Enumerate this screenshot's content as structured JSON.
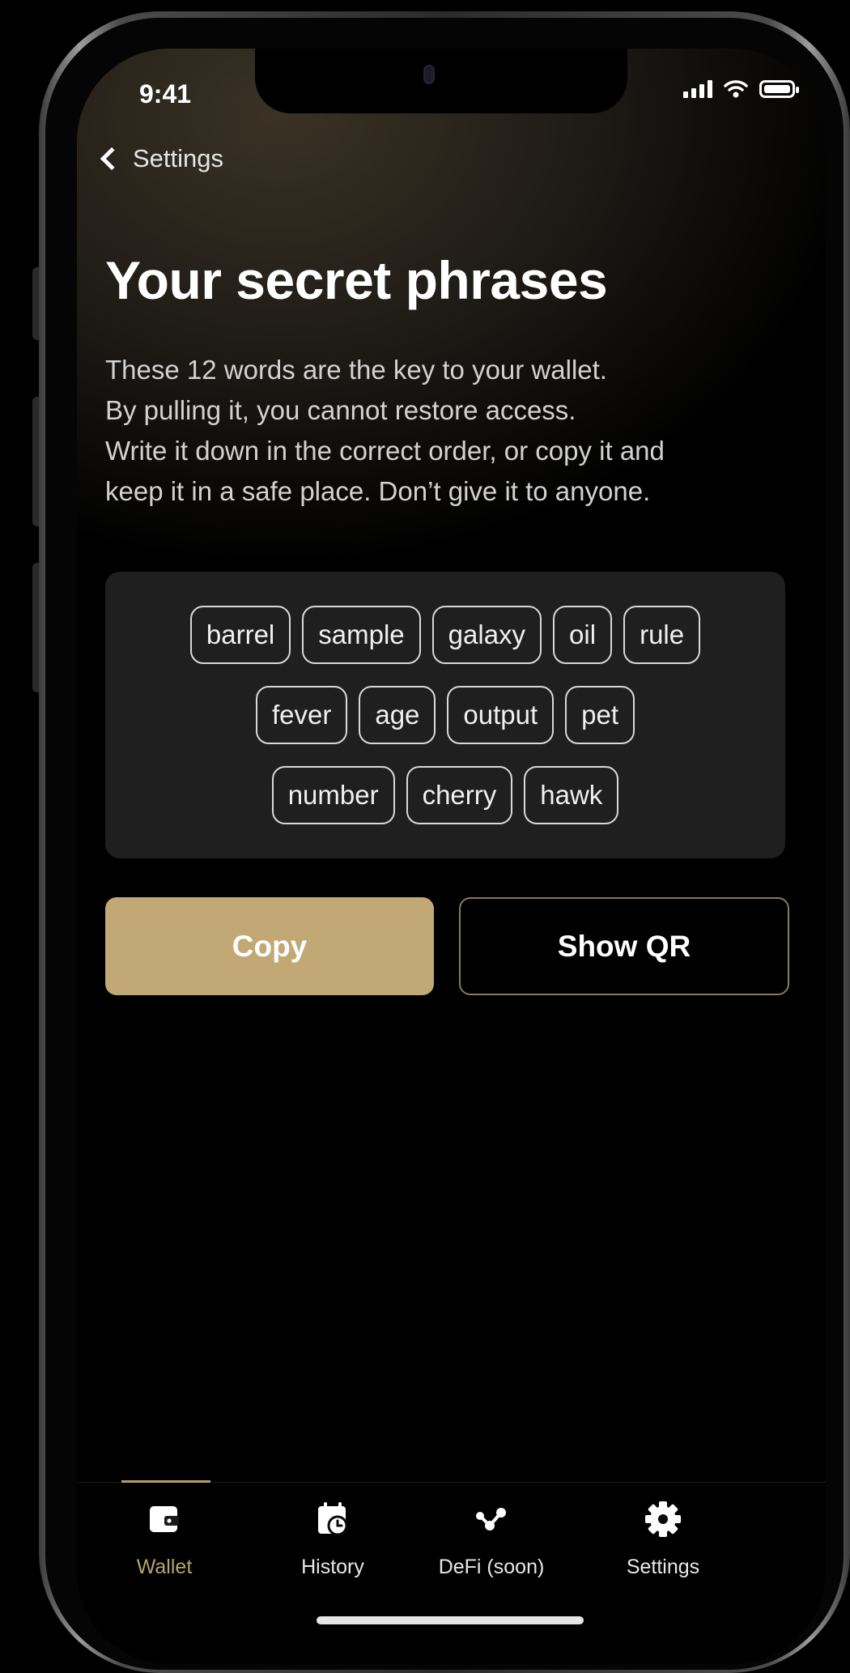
{
  "status_bar": {
    "time": "9:41"
  },
  "nav": {
    "back_label": "Settings"
  },
  "title": "Your secret phrases",
  "description": [
    "These 12 words are the key to your wallet.",
    "By pulling it, you cannot restore access.",
    "Write it down in the correct order, or copy it and",
    "keep it in a safe place. Don’t give it to anyone."
  ],
  "phrase_rows": [
    [
      "barrel",
      "sample",
      "galaxy",
      "oil",
      "rule"
    ],
    [
      "fever",
      "age",
      "output",
      "pet"
    ],
    [
      "number",
      "cherry",
      "hawk"
    ]
  ],
  "actions": {
    "copy_label": "Copy",
    "show_qr_label": "Show QR"
  },
  "tabbar": {
    "items": [
      {
        "label": "Wallet",
        "icon": "wallet-icon",
        "active": true
      },
      {
        "label": "History",
        "icon": "calendar-clock-icon",
        "active": false
      },
      {
        "label": "DeFi (soon)",
        "icon": "nodes-icon",
        "active": false
      },
      {
        "label": "Settings",
        "icon": "gear-icon",
        "active": false
      }
    ]
  },
  "colors": {
    "accent": "#c1a874",
    "background": "#000000",
    "chip_border": "#d9d9d9"
  }
}
